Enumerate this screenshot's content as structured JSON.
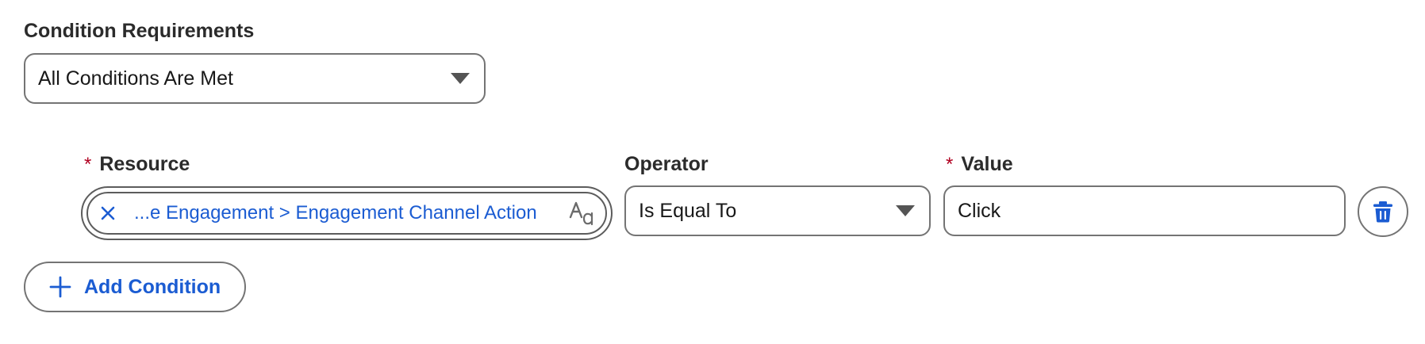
{
  "condition_requirements": {
    "label": "Condition Requirements",
    "selected": "All Conditions Are Met"
  },
  "condition_row": {
    "resource": {
      "required_mark": "*",
      "label": "Resource",
      "pill_text": "...e Engagement > Engagement Channel Action"
    },
    "operator": {
      "label": "Operator",
      "selected": "Is Equal To"
    },
    "value": {
      "required_mark": "*",
      "label": "Value",
      "text": "Click"
    }
  },
  "actions": {
    "add_condition_label": "Add Condition"
  },
  "colors": {
    "link_blue": "#1b5cd2",
    "required_red": "#b00020",
    "border_gray": "#747474"
  }
}
